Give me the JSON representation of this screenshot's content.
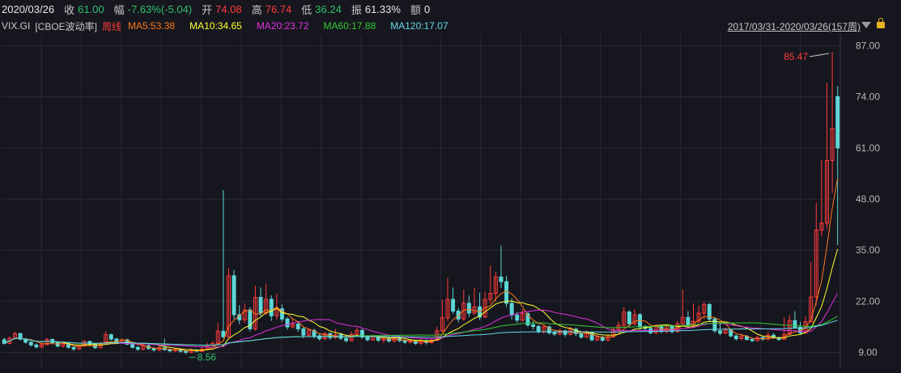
{
  "quote": {
    "date": "2020/03/26",
    "close_label": "收",
    "close_value": "61.00",
    "change_label": "幅",
    "change_value": "-7.63%(-5.04)",
    "open_label": "开",
    "open_value": "74.08",
    "high_label": "高",
    "high_value": "76.74",
    "low_label": "低",
    "low_value": "36.24",
    "amp_label": "振",
    "amp_value": "61.33%",
    "amount_label": "额",
    "amount_value": "0"
  },
  "ma_bar": {
    "symbol": "VIX.GI",
    "name": "[CBOE波动率]",
    "period": "周线",
    "ma5": "MA5:53.38",
    "ma10": "MA10:34.65",
    "ma20": "MA20:23.72",
    "ma60": "MA60:17.88",
    "ma120": "MA120:17.07",
    "range": "2017/03/31-2020/03/26(157周)"
  },
  "colors": {
    "up": "#ff3b3b",
    "down": "#5ed6d6",
    "ma5": "#ff7a1a",
    "ma10": "#ffff33",
    "ma20": "#e033e0",
    "ma60": "#33cc33",
    "ma120": "#66d9e8",
    "grid": "#2b2b38"
  },
  "chart_data": {
    "type": "candlestick",
    "title": "VIX.GI [CBOE波动率] 周线",
    "ylim": [
      5,
      90
    ],
    "y_ticks": [
      "87.00",
      "74.00",
      "61.00",
      "48.00",
      "35.00",
      "22.00",
      "9.00"
    ],
    "y_tick_values": [
      87,
      74,
      61,
      48,
      35,
      22,
      9
    ],
    "max_annotation": "85.47",
    "min_annotation": "8.56",
    "weeks": 157,
    "candles": [
      [
        12.2,
        11.3,
        12.8,
        11.0
      ],
      [
        11.3,
        12.6,
        13.1,
        11.0
      ],
      [
        12.6,
        13.8,
        14.2,
        12.3
      ],
      [
        13.8,
        12.4,
        14.0,
        12.0
      ],
      [
        12.4,
        11.6,
        12.7,
        11.2
      ],
      [
        11.6,
        10.9,
        11.8,
        10.5
      ],
      [
        10.9,
        10.4,
        11.3,
        10.0
      ],
      [
        10.4,
        11.0,
        11.5,
        10.1
      ],
      [
        11.0,
        12.3,
        12.7,
        10.8
      ],
      [
        12.3,
        11.5,
        12.6,
        11.2
      ],
      [
        11.5,
        10.6,
        11.8,
        10.3
      ],
      [
        10.6,
        11.2,
        11.6,
        10.2
      ],
      [
        11.2,
        10.3,
        11.5,
        10.0
      ],
      [
        10.3,
        9.9,
        10.5,
        9.4
      ],
      [
        9.9,
        10.6,
        11.0,
        9.6
      ],
      [
        10.6,
        11.8,
        12.2,
        10.4
      ],
      [
        11.8,
        11.1,
        12.0,
        10.8
      ],
      [
        11.1,
        10.2,
        11.4,
        9.9
      ],
      [
        10.2,
        11.3,
        11.7,
        10.0
      ],
      [
        11.3,
        13.5,
        14.4,
        11.1
      ],
      [
        13.5,
        12.4,
        13.8,
        12.0
      ],
      [
        12.4,
        11.5,
        12.7,
        11.2
      ],
      [
        11.5,
        12.2,
        12.6,
        11.2
      ],
      [
        12.2,
        11.1,
        12.5,
        10.8
      ],
      [
        11.1,
        10.3,
        11.4,
        10.0
      ],
      [
        10.3,
        9.8,
        10.6,
        9.4
      ],
      [
        9.8,
        10.7,
        11.1,
        9.5
      ],
      [
        10.7,
        10.0,
        11.0,
        9.6
      ],
      [
        10.0,
        9.6,
        10.3,
        9.2
      ],
      [
        9.6,
        10.2,
        10.6,
        9.3
      ],
      [
        10.2,
        9.7,
        12.5,
        9.4
      ],
      [
        9.7,
        9.4,
        10.0,
        9.0
      ],
      [
        9.4,
        9.8,
        10.2,
        9.1
      ],
      [
        9.8,
        9.3,
        10.1,
        8.9
      ],
      [
        9.3,
        9.0,
        9.6,
        8.56
      ],
      [
        9.0,
        9.6,
        10.0,
        8.8
      ],
      [
        9.6,
        9.3,
        9.9,
        9.0
      ],
      [
        9.3,
        9.9,
        10.3,
        9.1
      ],
      [
        9.9,
        10.8,
        11.5,
        9.7
      ],
      [
        10.8,
        11.3,
        11.9,
        10.5
      ],
      [
        11.3,
        14.4,
        16.5,
        11.2
      ],
      [
        14.4,
        13.0,
        50.3,
        12.5
      ],
      [
        13.0,
        28.5,
        30.5,
        12.8
      ],
      [
        28.5,
        18.6,
        30.0,
        17.5
      ],
      [
        18.6,
        17.3,
        21.0,
        16.2
      ],
      [
        17.3,
        19.8,
        21.5,
        16.5
      ],
      [
        19.8,
        15.0,
        20.5,
        14.3
      ],
      [
        15.0,
        23.0,
        26.0,
        14.5
      ],
      [
        23.0,
        19.0,
        25.5,
        18.2
      ],
      [
        19.0,
        22.5,
        26.5,
        18.5
      ],
      [
        22.5,
        18.3,
        23.5,
        17.0
      ],
      [
        18.3,
        20.1,
        24.0,
        17.3
      ],
      [
        20.1,
        17.5,
        21.2,
        16.8
      ],
      [
        17.5,
        15.5,
        18.0,
        14.8
      ],
      [
        15.5,
        16.2,
        17.4,
        15.0
      ],
      [
        16.2,
        15.0,
        16.8,
        14.2
      ],
      [
        15.0,
        13.4,
        15.5,
        12.6
      ],
      [
        13.4,
        14.6,
        15.2,
        12.8
      ],
      [
        14.6,
        13.2,
        15.0,
        12.5
      ],
      [
        13.2,
        12.5,
        13.8,
        12.0
      ],
      [
        12.5,
        13.8,
        14.2,
        12.1
      ],
      [
        13.8,
        12.8,
        14.1,
        12.2
      ],
      [
        12.8,
        13.5,
        15.0,
        12.4
      ],
      [
        13.5,
        12.6,
        14.0,
        12.1
      ],
      [
        12.6,
        12.0,
        13.1,
        11.5
      ],
      [
        12.0,
        13.6,
        14.3,
        11.8
      ],
      [
        13.6,
        14.6,
        15.4,
        13.1
      ],
      [
        14.6,
        12.9,
        15.0,
        12.5
      ],
      [
        12.9,
        12.2,
        13.4,
        11.8
      ],
      [
        12.2,
        13.0,
        13.5,
        11.9
      ],
      [
        13.0,
        12.1,
        13.3,
        11.6
      ],
      [
        12.1,
        12.5,
        12.9,
        11.4
      ],
      [
        12.5,
        11.9,
        12.9,
        11.5
      ],
      [
        11.9,
        12.6,
        13.0,
        11.5
      ],
      [
        12.6,
        12.0,
        13.2,
        11.6
      ],
      [
        12.0,
        11.6,
        12.3,
        11.1
      ],
      [
        11.6,
        11.9,
        12.4,
        11.3
      ],
      [
        11.9,
        11.3,
        12.2,
        10.9
      ],
      [
        11.3,
        12.0,
        12.5,
        10.9
      ],
      [
        12.0,
        11.5,
        12.3,
        11.0
      ],
      [
        11.5,
        12.1,
        12.6,
        11.2
      ],
      [
        12.1,
        14.5,
        15.5,
        11.9
      ],
      [
        14.5,
        17.8,
        22.5,
        14.0
      ],
      [
        17.8,
        22.5,
        28.0,
        17.0
      ],
      [
        22.5,
        19.5,
        25.5,
        18.8
      ],
      [
        19.5,
        17.5,
        20.3,
        16.6
      ],
      [
        17.5,
        21.5,
        25.0,
        17.0
      ],
      [
        21.5,
        19.0,
        23.5,
        18.0
      ],
      [
        19.0,
        20.6,
        25.5,
        18.5
      ],
      [
        20.6,
        18.0,
        24.2,
        17.2
      ],
      [
        18.0,
        22.5,
        24.5,
        17.7
      ],
      [
        22.5,
        24.0,
        31.0,
        21.5
      ],
      [
        24.0,
        28.2,
        29.5,
        22.0
      ],
      [
        28.2,
        27.0,
        36.2,
        25.4
      ],
      [
        27.0,
        21.5,
        28.5,
        20.5
      ],
      [
        21.5,
        18.5,
        22.8,
        17.4
      ],
      [
        18.5,
        17.2,
        19.3,
        16.5
      ],
      [
        17.2,
        18.9,
        20.0,
        16.8
      ],
      [
        18.9,
        16.0,
        19.2,
        15.5
      ],
      [
        16.0,
        15.6,
        17.0,
        14.8
      ],
      [
        15.6,
        14.3,
        16.0,
        13.8
      ],
      [
        14.3,
        15.5,
        15.9,
        13.7
      ],
      [
        15.5,
        14.0,
        15.8,
        13.5
      ],
      [
        14.0,
        13.7,
        14.6,
        13.1
      ],
      [
        13.7,
        14.5,
        15.0,
        13.3
      ],
      [
        14.5,
        13.6,
        14.8,
        13.0
      ],
      [
        13.6,
        14.9,
        15.6,
        13.2
      ],
      [
        14.9,
        13.8,
        15.3,
        13.1
      ],
      [
        13.8,
        12.9,
        14.1,
        12.5
      ],
      [
        12.9,
        14.0,
        14.6,
        12.7
      ],
      [
        14.0,
        12.2,
        14.3,
        11.8
      ],
      [
        12.2,
        12.9,
        13.4,
        11.8
      ],
      [
        12.9,
        12.1,
        13.2,
        11.7
      ],
      [
        12.1,
        13.0,
        13.6,
        11.8
      ],
      [
        13.0,
        14.8,
        15.4,
        12.7
      ],
      [
        14.8,
        15.9,
        16.8,
        14.2
      ],
      [
        15.9,
        19.3,
        20.5,
        15.4
      ],
      [
        19.3,
        16.3,
        19.8,
        15.6
      ],
      [
        16.3,
        18.6,
        20.0,
        15.8
      ],
      [
        18.6,
        15.5,
        19.0,
        14.8
      ],
      [
        15.5,
        15.1,
        16.0,
        14.5
      ],
      [
        15.1,
        14.0,
        15.5,
        13.6
      ],
      [
        14.0,
        15.6,
        16.2,
        13.6
      ],
      [
        15.6,
        14.3,
        16.0,
        13.9
      ],
      [
        14.3,
        15.7,
        16.1,
        13.8
      ],
      [
        15.7,
        14.3,
        16.0,
        13.8
      ],
      [
        14.3,
        16.3,
        17.0,
        14.0
      ],
      [
        16.3,
        17.9,
        25.0,
        16.0
      ],
      [
        17.9,
        15.8,
        19.5,
        15.1
      ],
      [
        15.8,
        16.9,
        21.5,
        15.3
      ],
      [
        16.9,
        19.0,
        20.9,
        16.1
      ],
      [
        19.0,
        21.2,
        21.9,
        17.5
      ],
      [
        21.2,
        17.5,
        21.5,
        16.8
      ],
      [
        17.5,
        14.5,
        18.0,
        14.0
      ],
      [
        14.5,
        13.9,
        16.5,
        13.4
      ],
      [
        13.9,
        14.7,
        15.3,
        13.6
      ],
      [
        14.7,
        13.2,
        15.0,
        12.8
      ],
      [
        13.2,
        12.5,
        13.5,
        12.0
      ],
      [
        12.5,
        13.1,
        13.7,
        12.1
      ],
      [
        13.1,
        12.3,
        13.4,
        12.0
      ],
      [
        12.3,
        12.0,
        12.6,
        11.6
      ],
      [
        12.0,
        12.8,
        13.3,
        11.8
      ],
      [
        12.8,
        12.4,
        13.0,
        12.0
      ],
      [
        12.4,
        13.4,
        14.2,
        12.1
      ],
      [
        13.4,
        12.7,
        13.9,
        12.4
      ],
      [
        12.7,
        12.3,
        13.1,
        11.9
      ],
      [
        12.3,
        13.6,
        17.8,
        12.2
      ],
      [
        13.6,
        17.1,
        18.5,
        13.3
      ],
      [
        17.1,
        15.4,
        19.5,
        15.0
      ],
      [
        15.4,
        14.0,
        16.8,
        13.5
      ],
      [
        14.0,
        16.8,
        18.2,
        13.8
      ],
      [
        16.8,
        23.1,
        32.0,
        16.5
      ],
      [
        23.1,
        40.1,
        47.0,
        21.0
      ],
      [
        40.1,
        41.9,
        58.0,
        38.5
      ],
      [
        41.9,
        57.8,
        77.6,
        40.5
      ],
      [
        57.8,
        66.0,
        85.47,
        49.5
      ],
      [
        74.08,
        61.0,
        76.74,
        36.24
      ]
    ],
    "ma_series_names": [
      "MA5",
      "MA10",
      "MA20",
      "MA60",
      "MA120"
    ],
    "ma_last_values": [
      53.38,
      34.65,
      23.72,
      17.88,
      17.07
    ]
  }
}
